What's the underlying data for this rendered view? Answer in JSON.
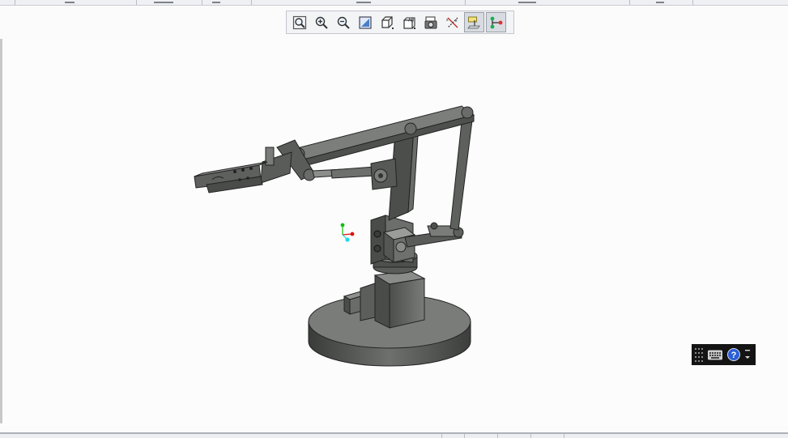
{
  "toolbar": {
    "buttons": [
      {
        "name": "zoom-fit-button",
        "icon": "zoom-fit-icon",
        "active": false
      },
      {
        "name": "zoom-in-button",
        "icon": "zoom-in-icon",
        "active": false
      },
      {
        "name": "zoom-out-button",
        "icon": "zoom-out-icon",
        "active": false
      },
      {
        "name": "repaint-button",
        "icon": "repaint-icon",
        "active": false
      },
      {
        "name": "display-style-button",
        "icon": "cube-icon",
        "active": false
      },
      {
        "name": "named-views-button",
        "icon": "named-view-icon",
        "active": false
      },
      {
        "name": "saved-orientations-button",
        "icon": "camera-icon",
        "active": false
      },
      {
        "name": "datum-display-button",
        "icon": "datum-icon",
        "active": false
      },
      {
        "name": "plane-display-button",
        "icon": "plane-icon",
        "active": true
      },
      {
        "name": "spin-center-button",
        "icon": "spin-center-icon",
        "active": true
      }
    ]
  },
  "mini_toolbar": {
    "icons": [
      "grip-icon",
      "keyboard-icon",
      "help-icon",
      "more-icon"
    ]
  },
  "colors": {
    "model_dark": "#3f413f",
    "model_mid": "#5e605e",
    "model_light": "#7c7e7c",
    "axis_x": "#e01010",
    "axis_y": "#10c010",
    "axis_z": "#20d8e8",
    "help_blue": "#2a5fd6"
  }
}
